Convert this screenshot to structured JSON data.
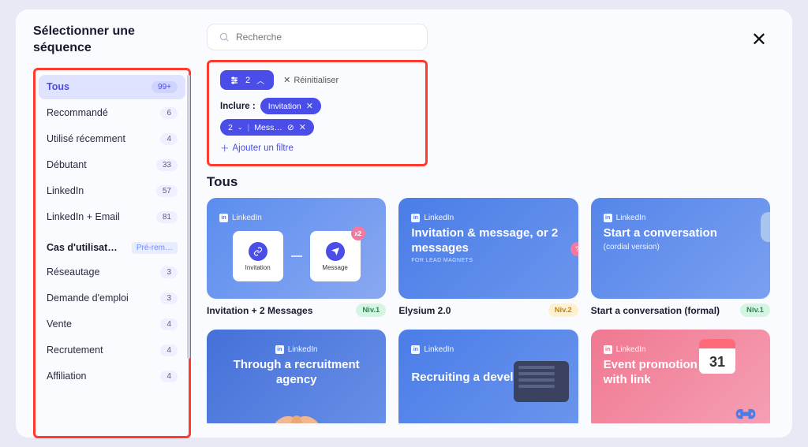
{
  "modal_title": "Sélectionner une séquence",
  "search": {
    "placeholder": "Recherche"
  },
  "sidebar": {
    "items": [
      {
        "label": "Tous",
        "badge": "99+",
        "active": true
      },
      {
        "label": "Recommandé",
        "badge": "6"
      },
      {
        "label": "Utilisé récemment",
        "badge": "4"
      },
      {
        "label": "Débutant",
        "badge": "33"
      },
      {
        "label": "LinkedIn",
        "badge": "57"
      },
      {
        "label": "LinkedIn + Email",
        "badge": "81"
      }
    ],
    "section_label": "Cas d'utilisat…",
    "section_tag": "Pré-rem…",
    "usecases": [
      {
        "label": "Réseautage",
        "badge": "3"
      },
      {
        "label": "Demande d'emploi",
        "badge": "3"
      },
      {
        "label": "Vente",
        "badge": "4"
      },
      {
        "label": "Recrutement",
        "badge": "4"
      },
      {
        "label": "Affiliation",
        "badge": "4"
      }
    ]
  },
  "filters": {
    "count": "2",
    "reset": "Réinitialiser",
    "include_label": "Inclure :",
    "chips": [
      {
        "label": "Invitation",
        "closable": true
      },
      {
        "label": "Mess…",
        "prefix": "2",
        "blocked": true
      }
    ],
    "chip1": "Invitation",
    "chip2_prefix": "2",
    "chip2_label": "Mess…",
    "add_label": "Ajouter un filtre"
  },
  "section_heading": "Tous",
  "cards": [
    {
      "platform": "LinkedIn",
      "flow_a": "Invitation",
      "flow_b": "Message",
      "x2": "x2",
      "title": "Invitation + 2 Messages",
      "level": "Niv.1",
      "level_class": "n1"
    },
    {
      "platform": "LinkedIn",
      "headline": "Invitation & message, or 2 messages",
      "small": "FOR LEAD MAGNETS",
      "title": "Elysium 2.0",
      "level": "Niv.2",
      "level_class": "n2"
    },
    {
      "platform": "LinkedIn",
      "headline": "Start a conversation",
      "sub": "(cordial version)",
      "title": "Start a conversation (formal)",
      "level": "Niv.1",
      "level_class": "n1"
    },
    {
      "platform": "LinkedIn",
      "headline": "Through a recruitment agency",
      "title": "",
      "level": ""
    },
    {
      "platform": "LinkedIn",
      "headline": "Recruiting a developer",
      "title": "",
      "level": ""
    },
    {
      "platform": "LinkedIn",
      "headline": "Event promotion with link",
      "calnum": "31",
      "title": "",
      "level": ""
    }
  ]
}
